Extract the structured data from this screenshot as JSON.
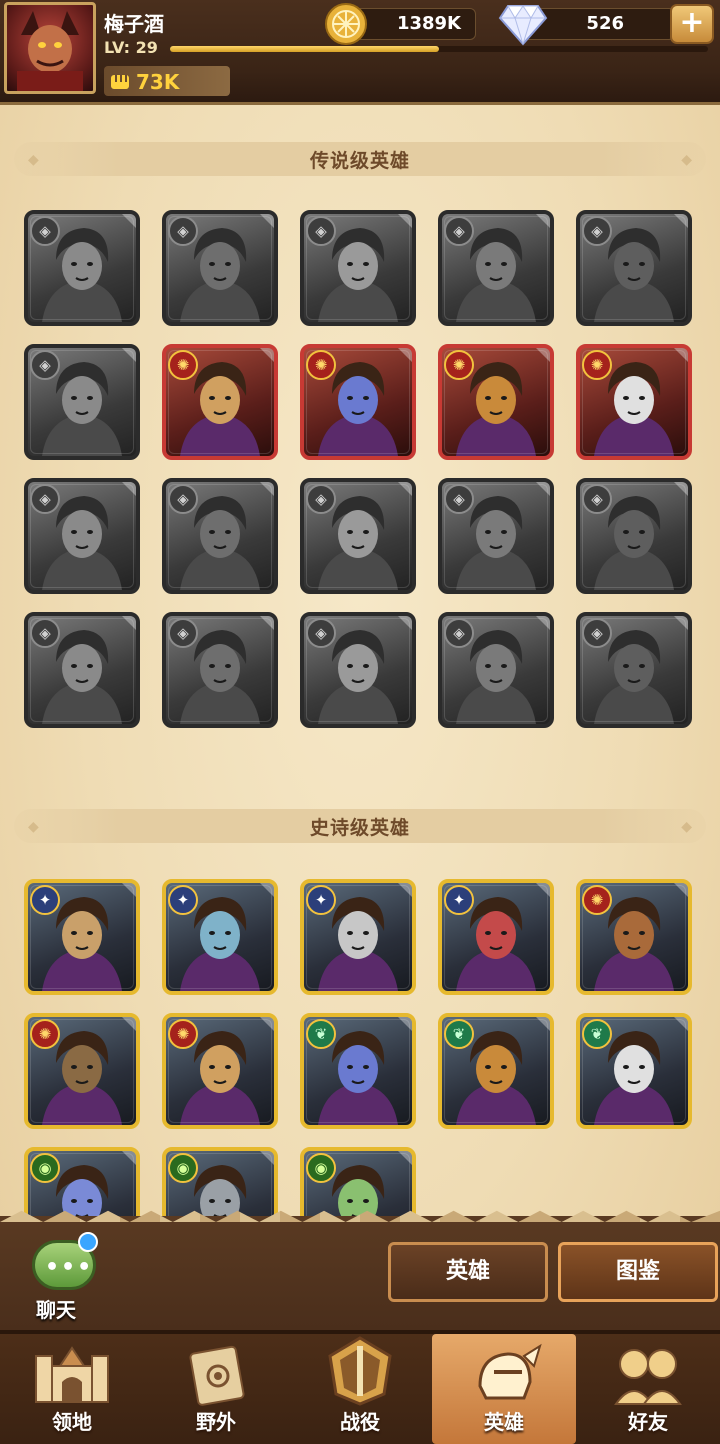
{
  "player": {
    "name": "梅子酒",
    "level_label": "LV: 29",
    "xp_fraction": 0.5,
    "power": "73K"
  },
  "resources": {
    "gold": "1389K",
    "gems": "526"
  },
  "sections": {
    "legendary_title": "传说级英雄",
    "epic_title": "史诗级英雄"
  },
  "legendary_heroes": [
    {
      "faction": "gray",
      "owned": false
    },
    {
      "faction": "gray",
      "owned": false
    },
    {
      "faction": "gray",
      "owned": false
    },
    {
      "faction": "gray",
      "owned": false
    },
    {
      "faction": "gray",
      "owned": false
    },
    {
      "faction": "gray",
      "owned": false
    },
    {
      "faction": "sun",
      "owned": true
    },
    {
      "faction": "sun",
      "owned": true
    },
    {
      "faction": "sun",
      "owned": true
    },
    {
      "faction": "sun",
      "owned": true
    },
    {
      "faction": "gray",
      "owned": false
    },
    {
      "faction": "gray",
      "owned": false
    },
    {
      "faction": "gray",
      "owned": false
    },
    {
      "faction": "gray",
      "owned": false
    },
    {
      "faction": "gray",
      "owned": false
    },
    {
      "faction": "gray",
      "owned": false
    },
    {
      "faction": "gray",
      "owned": false
    },
    {
      "faction": "gray",
      "owned": false
    },
    {
      "faction": "gray",
      "owned": false
    },
    {
      "faction": "gray",
      "owned": false
    }
  ],
  "epic_heroes": [
    {
      "faction": "star",
      "owned": true
    },
    {
      "faction": "star",
      "owned": true
    },
    {
      "faction": "star",
      "owned": true
    },
    {
      "faction": "star",
      "owned": true
    },
    {
      "faction": "sun",
      "owned": true
    },
    {
      "faction": "sun",
      "owned": true
    },
    {
      "faction": "sun",
      "owned": true
    },
    {
      "faction": "leaf",
      "owned": true
    },
    {
      "faction": "leaf",
      "owned": true
    },
    {
      "faction": "leaf",
      "owned": true
    },
    {
      "faction": "eye",
      "owned": true
    },
    {
      "faction": "eye",
      "owned": true
    },
    {
      "faction": "eye",
      "owned": true
    }
  ],
  "chat": {
    "label": "聊天",
    "dots": "•••"
  },
  "tabs": {
    "hero": "英雄",
    "codex": "图鉴"
  },
  "nav": [
    {
      "label": "领地",
      "icon": "castle-icon"
    },
    {
      "label": "野外",
      "icon": "map-scroll-icon"
    },
    {
      "label": "战役",
      "icon": "sword-emblem-icon"
    },
    {
      "label": "英雄",
      "icon": "hero-helmet-icon"
    },
    {
      "label": "好友",
      "icon": "friends-icon"
    }
  ],
  "plus_label": "+"
}
